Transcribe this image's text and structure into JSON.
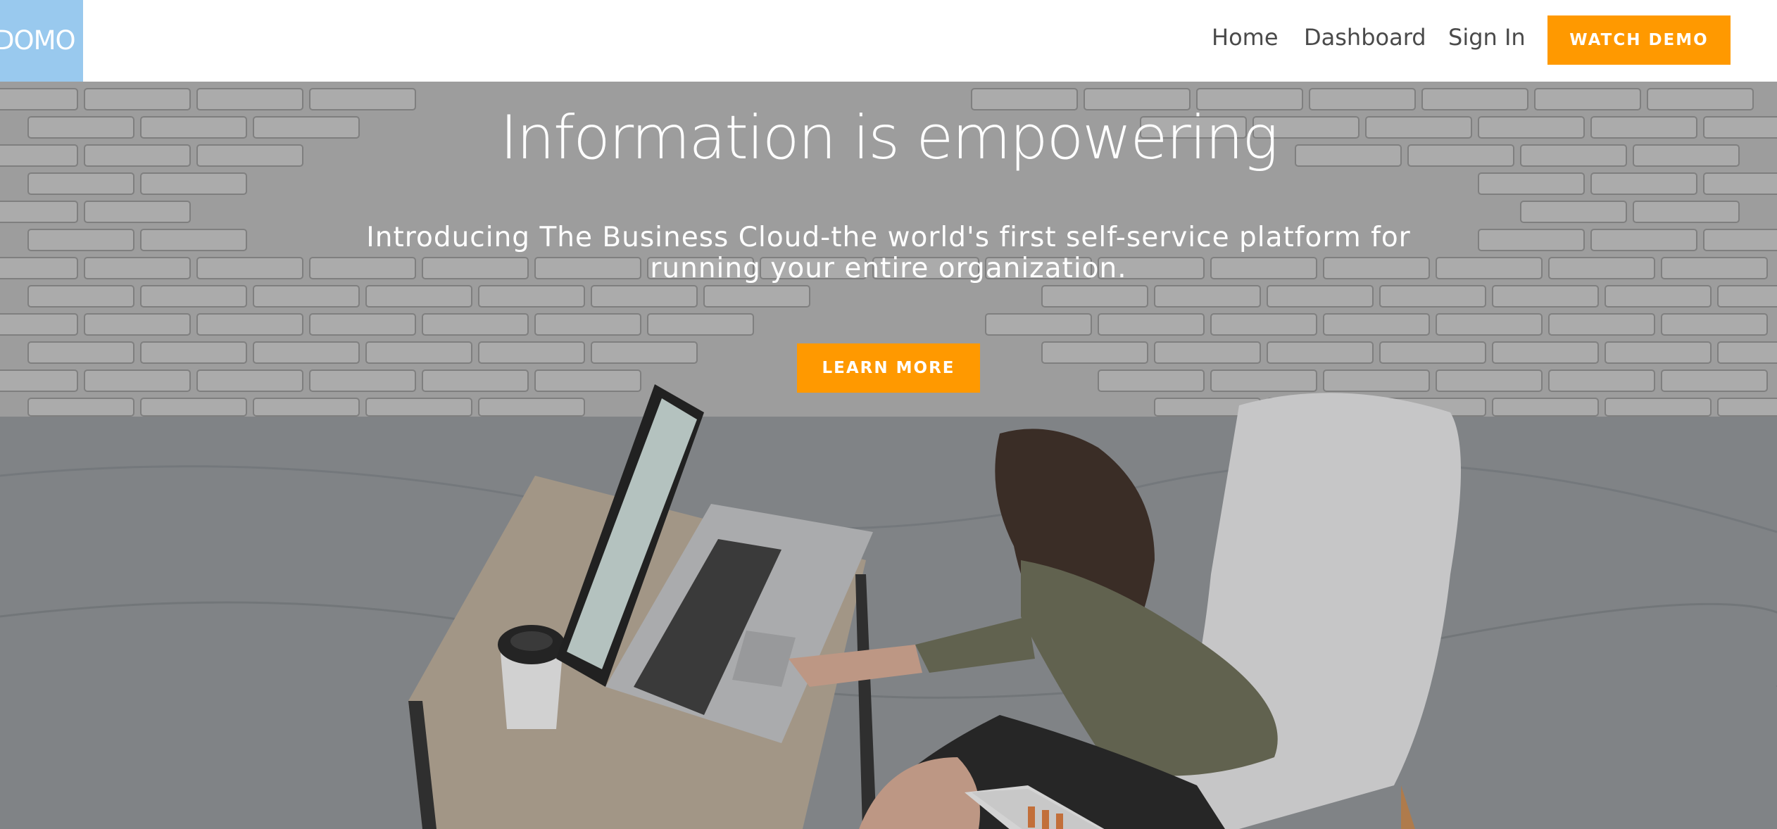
{
  "header": {
    "logo_text": "DOMO",
    "nav": {
      "home": "Home",
      "dashboard": "Dashboard",
      "sign_in": "Sign In"
    },
    "cta_label": "WATCH DEMO"
  },
  "hero": {
    "title": "Information is empowering",
    "subtitle": "Introducing The Business Cloud-the world's first self-service platform for running your entire organization.",
    "cta_label": "LEARN MORE"
  },
  "colors": {
    "accent": "#ff9900",
    "logo_bg": "#99c9ee",
    "nav_text": "#4a4a4a"
  }
}
